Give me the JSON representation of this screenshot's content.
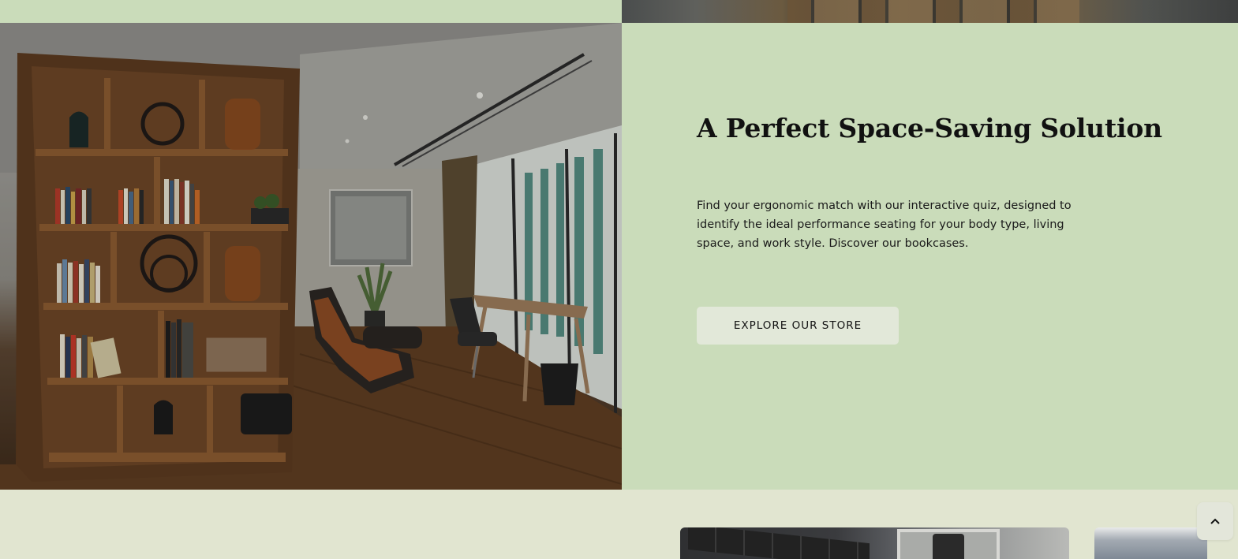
{
  "feature": {
    "title": "A Perfect Space-Saving Solution",
    "body": "Find your ergonomic match with our interactive quiz, designed to identify the ideal performance seating for your body type, living space, and work style. Discover our bookcases.",
    "cta_label": "EXPLORE OUR STORE",
    "background": "#cadcba",
    "cta_background": "#e2e8d9"
  },
  "page": {
    "background": "#e1e5d0"
  },
  "scroll_top": {
    "icon": "chevron-up-icon"
  }
}
